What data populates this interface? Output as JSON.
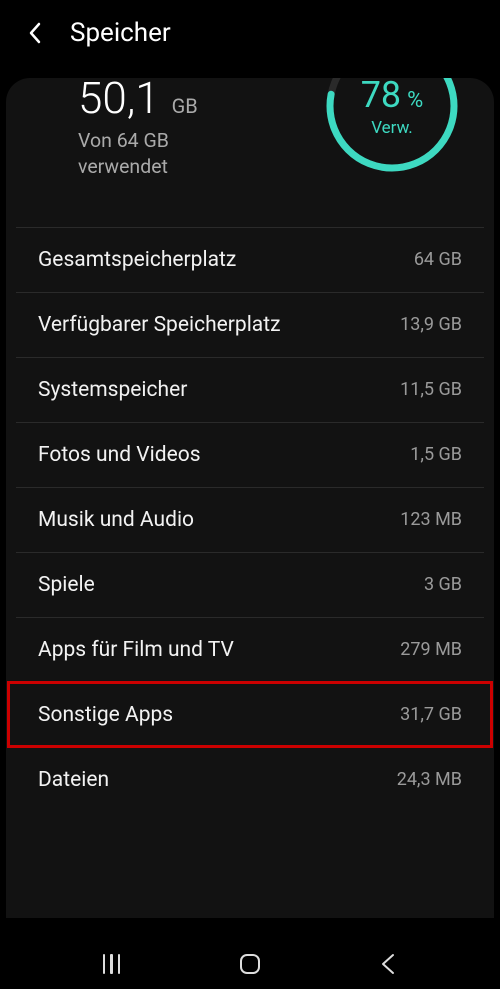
{
  "header": {
    "title": "Speicher"
  },
  "summary": {
    "used_value": "50,1",
    "used_unit": "GB",
    "sub_line1": "Von 64 GB",
    "sub_line2": "verwendet",
    "percent": "78",
    "percent_symbol": "%",
    "percent_label": "Verw.",
    "percent_value": 78
  },
  "items": [
    {
      "label": "Gesamtspeicherplatz",
      "value": "64 GB"
    },
    {
      "label": "Verfügbarer Speicherplatz",
      "value": "13,9 GB"
    },
    {
      "label": "Systemspeicher",
      "value": "11,5 GB"
    },
    {
      "label": "Fotos und Videos",
      "value": "1,5 GB"
    },
    {
      "label": "Musik und Audio",
      "value": "123 MB"
    },
    {
      "label": "Spiele",
      "value": "3 GB"
    },
    {
      "label": "Apps für Film und TV",
      "value": "279 MB"
    },
    {
      "label": "Sonstige Apps",
      "value": "31,7 GB",
      "highlighted": true
    },
    {
      "label": "Dateien",
      "value": "24,3 MB"
    }
  ],
  "colors": {
    "accent": "#3dd9c1",
    "highlight_border": "#cc0000"
  }
}
